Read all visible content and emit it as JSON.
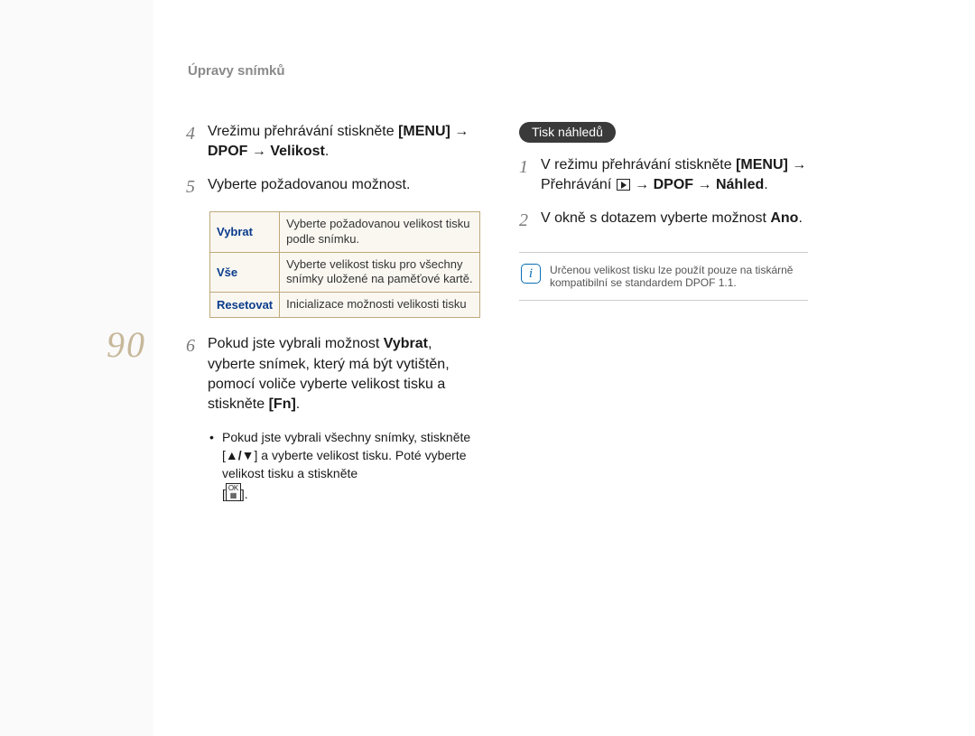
{
  "header": {
    "title": "Úpravy snímků"
  },
  "page_number": "90",
  "left": {
    "step4": {
      "num": "4",
      "text_a": "Vrežimu přehrávání stiskněte ",
      "menu": "[MENU]",
      "arrow1": " → ",
      "dpof": "DPOF",
      "arrow2": " → ",
      "velikost": "Velikost",
      "dot": "."
    },
    "step5": {
      "num": "5",
      "text": "Vyberte požadovanou možnost."
    },
    "table": [
      {
        "label": "Vybrat",
        "desc": "Vyberte požadovanou velikost tisku podle snímku."
      },
      {
        "label": "Vše",
        "desc": "Vyberte velikost tisku pro všechny snímky uložené na paměťové kartě."
      },
      {
        "label": "Resetovat",
        "desc": "Inicializace možnosti velikosti tisku"
      }
    ],
    "step6": {
      "num": "6",
      "a": "Pokud jste vybrali možnost ",
      "vybrat": "Vybrat",
      "b": ", vyberte snímek, který má být vytištěn, pomocí voliče vyberte velikost tisku a stiskněte ",
      "fn": "[Fn]",
      "dot": "."
    },
    "bullet": {
      "a": "Pokud jste vybrali všechny snímky, stiskněte [",
      "updown": "▲/▼",
      "b": "] a vyberte velikost tisku. Poté vyberte velikost tisku a stiskněte ",
      "c": "[",
      "ok_top": "OK",
      "ok_bot": "▦",
      "d": "]."
    }
  },
  "right": {
    "pill": "Tisk náhledů",
    "step1": {
      "num": "1",
      "a": "V režimu přehrávání stiskněte ",
      "menu": "[MENU]",
      "b": " → Přehrávání ",
      "c": " → ",
      "dpof": "DPOF",
      "d": " → ",
      "nahled": "Náhled",
      "dot": "."
    },
    "step2": {
      "num": "2",
      "a": "V okně s dotazem vyberte možnost ",
      "ano": "Ano",
      "dot": "."
    },
    "note": {
      "text": "Určenou velikost tisku lze použít pouze na tiskárně kompatibilní se standardem DPOF 1.1."
    }
  }
}
